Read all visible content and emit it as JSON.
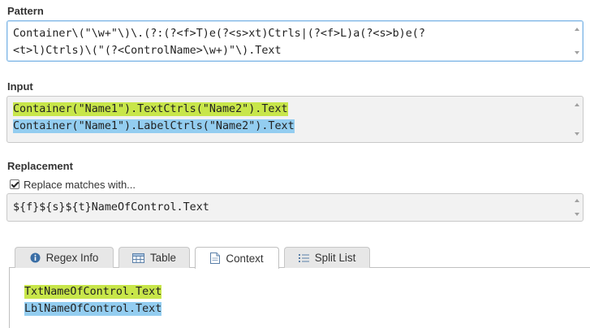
{
  "pattern": {
    "label": "Pattern",
    "lines": [
      "Container\\(\"\\w+\"\\)\\.(?:(?<f>T)e(?<s>xt)Ctrls|(?<f>L)a(?<s>b)e(?",
      "<t>l)Ctrls)\\(\"(?<ControlName>\\w+)\"\\).Text"
    ]
  },
  "input": {
    "label": "Input",
    "lines": [
      {
        "text": "Container(\"Name1\").TextCtrls(\"Name2\").Text",
        "highlight": "green"
      },
      {
        "text": "Container(\"Name1\").LabelCtrls(\"Name2\").Text",
        "highlight": "blue"
      }
    ]
  },
  "replacement": {
    "label": "Replacement",
    "checkbox_label": "Replace matches with...",
    "checked": true,
    "value": "${f}${s}${t}NameOfControl.Text"
  },
  "tabs": [
    {
      "label": "Regex Info",
      "icon": "info-icon",
      "active": false
    },
    {
      "label": "Table",
      "icon": "table-icon",
      "active": false
    },
    {
      "label": "Context",
      "icon": "document-icon",
      "active": true
    },
    {
      "label": "Split List",
      "icon": "list-icon",
      "active": false
    }
  ],
  "context": {
    "lines": [
      {
        "text": "TxtNameOfControl.Text",
        "highlight": "green"
      },
      {
        "text": "LblNameOfControl.Text",
        "highlight": "blue"
      }
    ]
  },
  "colors": {
    "highlight_green": "#c8e64a",
    "highlight_blue": "#93cdf0",
    "focus_border": "#7fb6e6"
  }
}
